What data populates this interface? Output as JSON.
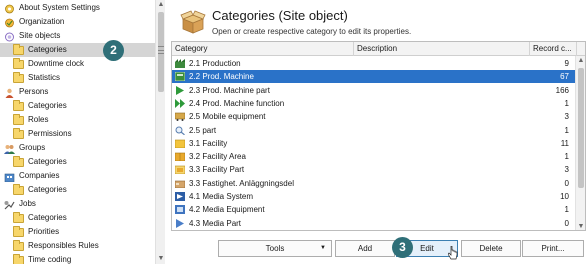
{
  "tree": {
    "items": [
      {
        "label": "About System Settings",
        "indent": 0,
        "icon": "settings-gear-icon"
      },
      {
        "label": "Organization",
        "indent": 0,
        "icon": "organization-icon"
      },
      {
        "label": "Site objects",
        "indent": 0,
        "icon": "site-objects-icon"
      },
      {
        "label": "Categories",
        "indent": 1,
        "icon": "folder-icon",
        "selected": true
      },
      {
        "label": "Downtime clock",
        "indent": 1,
        "icon": "folder-icon"
      },
      {
        "label": "Statistics",
        "indent": 1,
        "icon": "folder-icon"
      },
      {
        "label": "Persons",
        "indent": 0,
        "icon": "persons-icon"
      },
      {
        "label": "Categories",
        "indent": 1,
        "icon": "folder-icon"
      },
      {
        "label": "Roles",
        "indent": 1,
        "icon": "folder-icon"
      },
      {
        "label": "Permissions",
        "indent": 1,
        "icon": "folder-icon"
      },
      {
        "label": "Groups",
        "indent": 0,
        "icon": "groups-icon"
      },
      {
        "label": "Categories",
        "indent": 1,
        "icon": "folder-icon"
      },
      {
        "label": "Companies",
        "indent": 0,
        "icon": "companies-icon"
      },
      {
        "label": "Categories",
        "indent": 1,
        "icon": "folder-icon"
      },
      {
        "label": "Jobs",
        "indent": 0,
        "icon": "jobs-icon"
      },
      {
        "label": "Categories",
        "indent": 1,
        "icon": "folder-icon"
      },
      {
        "label": "Priorities",
        "indent": 1,
        "icon": "folder-icon"
      },
      {
        "label": "Responsibles Rules",
        "indent": 1,
        "icon": "folder-icon"
      },
      {
        "label": "Time coding",
        "indent": 1,
        "icon": "folder-icon"
      }
    ]
  },
  "callouts": {
    "c2": "2",
    "c3": "3"
  },
  "header": {
    "title": "Categories (Site object)",
    "subtitle": "Open or create respective category to edit its properties."
  },
  "grid": {
    "columns": [
      "Category",
      "Description",
      "Record c..."
    ],
    "rows": [
      {
        "name": "2.1 Production",
        "count": "9",
        "icon": "factory-icon"
      },
      {
        "name": "2.2 Prod. Machine",
        "count": "67",
        "icon": "machine-icon",
        "selected": true
      },
      {
        "name": "2.3 Prod. Machine part",
        "count": "166",
        "icon": "play-arrow-icon"
      },
      {
        "name": "2.4 Prod. Machine function",
        "count": "1",
        "icon": "fast-forward-icon"
      },
      {
        "name": "2.5 Mobile equipment",
        "count": "3",
        "icon": "mobile-equipment-icon"
      },
      {
        "name": "2.5 part",
        "count": "1",
        "icon": "magnifier-icon"
      },
      {
        "name": "3.1 Facility",
        "count": "11",
        "icon": "facility-icon"
      },
      {
        "name": "3.2 Facility Area",
        "count": "1",
        "icon": "facility-area-icon"
      },
      {
        "name": "3.3 Facility Part",
        "count": "3",
        "icon": "facility-part-icon"
      },
      {
        "name": "3.3 Fastighet. Anläggningsdel",
        "count": "0",
        "icon": "building-part-icon"
      },
      {
        "name": "4.1 Media System",
        "count": "10",
        "icon": "media-system-icon"
      },
      {
        "name": "4.2 Media Equipment",
        "count": "1",
        "icon": "media-equipment-icon"
      },
      {
        "name": "4.3 Media Part",
        "count": "0",
        "icon": "media-part-icon"
      }
    ]
  },
  "buttons": {
    "tools": "Tools",
    "add": "Add",
    "edit": "Edit",
    "delete": "Delete",
    "print": "Print..."
  },
  "colors": {
    "selection": "#2a72c8",
    "callout": "#2f6f78",
    "folder": "#f7d66b"
  }
}
